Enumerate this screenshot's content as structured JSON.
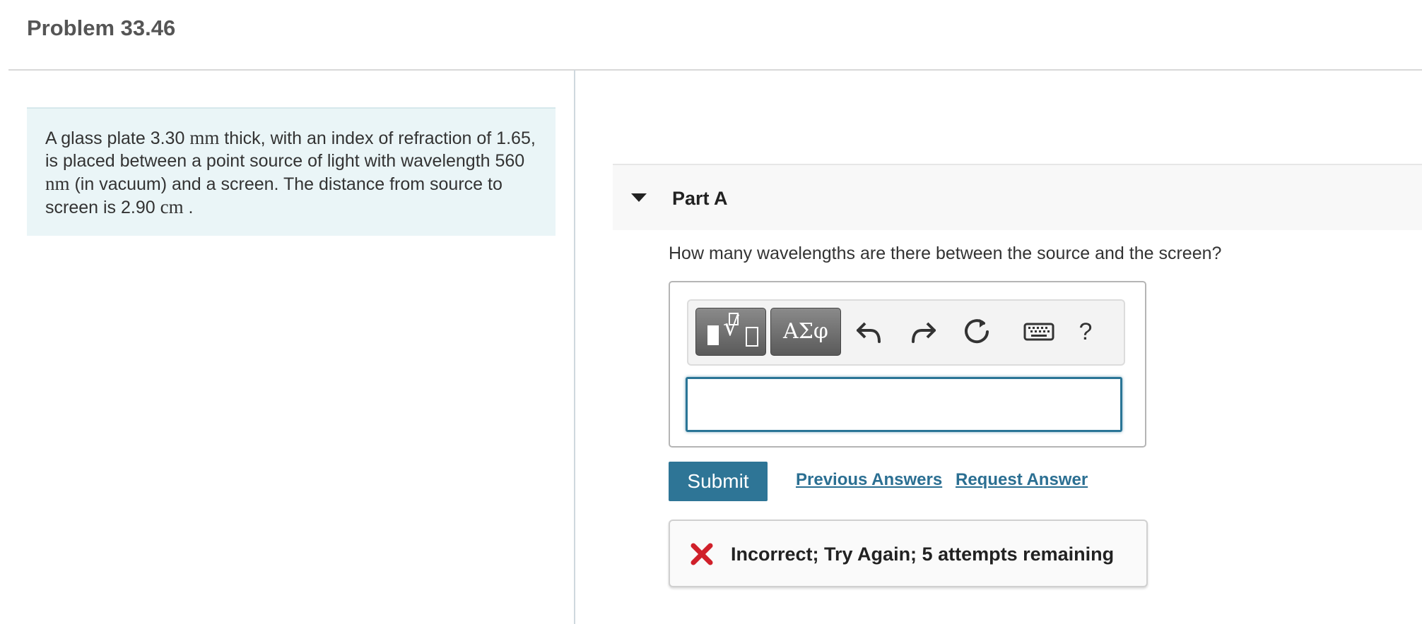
{
  "header": {
    "title": "Problem 33.46"
  },
  "problem": {
    "t1": "A glass plate 3.30 ",
    "u1": "mm",
    "t2": " thick, with an index of refraction of 1.65, is placed between a point source of light with wavelength 560 ",
    "u2": "nm",
    "t3": " (in vacuum) and a screen. The distance from source to screen is 2.90 ",
    "u3": "cm",
    "t4": " ."
  },
  "part": {
    "title": "Part A",
    "question": "How many wavelengths are there between the source and the screen?"
  },
  "toolbar": {
    "greek_label": "ΑΣφ",
    "help_label": "?",
    "icons": [
      "templates-icon",
      "greek-letters-icon",
      "undo-icon",
      "redo-icon",
      "reset-icon",
      "keyboard-icon",
      "help-icon"
    ]
  },
  "answer": {
    "value": ""
  },
  "actions": {
    "submit_label": "Submit",
    "previous_answers_label": "Previous Answers",
    "request_answer_label": "Request Answer"
  },
  "feedback": {
    "text": "Incorrect; Try Again; 5 attempts remaining",
    "status_color": "#d0202a"
  },
  "colors": {
    "accent": "#2e7596",
    "problem_bg": "#eaf5f7"
  }
}
